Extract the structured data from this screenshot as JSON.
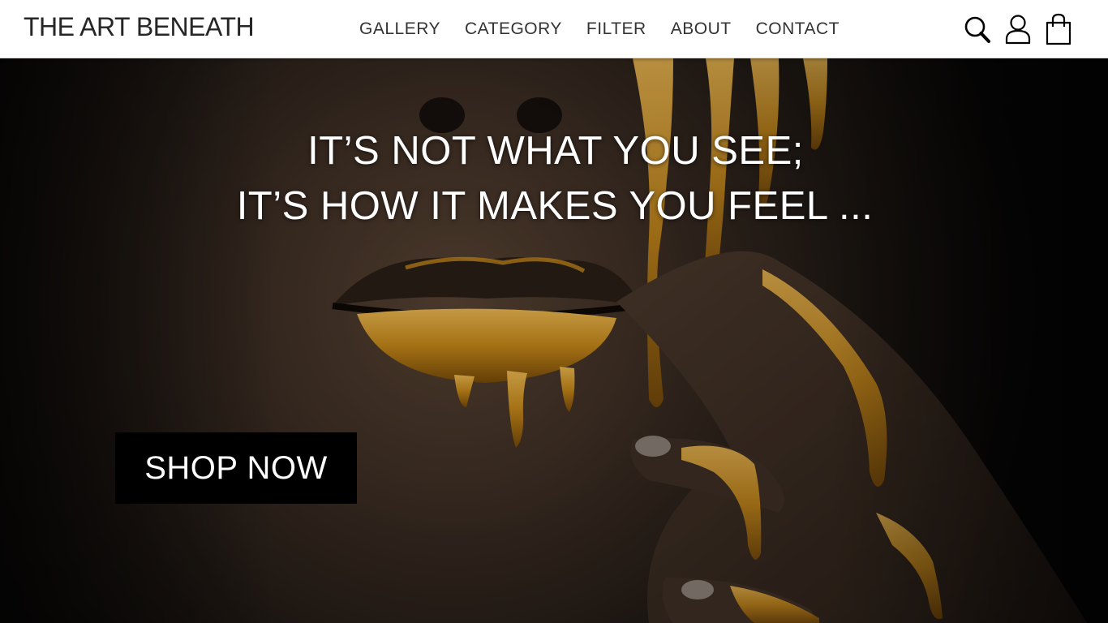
{
  "brand": {
    "name": "THE ART BENEATH"
  },
  "nav": {
    "items": [
      {
        "label": "GALLERY"
      },
      {
        "label": "CATEGORY"
      },
      {
        "label": "FILTER"
      },
      {
        "label": "ABOUT"
      },
      {
        "label": "CONTACT"
      }
    ]
  },
  "icons": {
    "search": "search-icon",
    "account": "user-icon",
    "cart": "shopping-bag-icon"
  },
  "hero": {
    "line1": "IT’S NOT WHAT YOU SEE;",
    "line2": "IT’S HOW IT MAKES YOU FEEL ...",
    "cta_label": "SHOP NOW"
  },
  "colors": {
    "accent_gold": "#c98a1a",
    "button_bg": "#000000",
    "nav_bg": "#ffffff"
  }
}
